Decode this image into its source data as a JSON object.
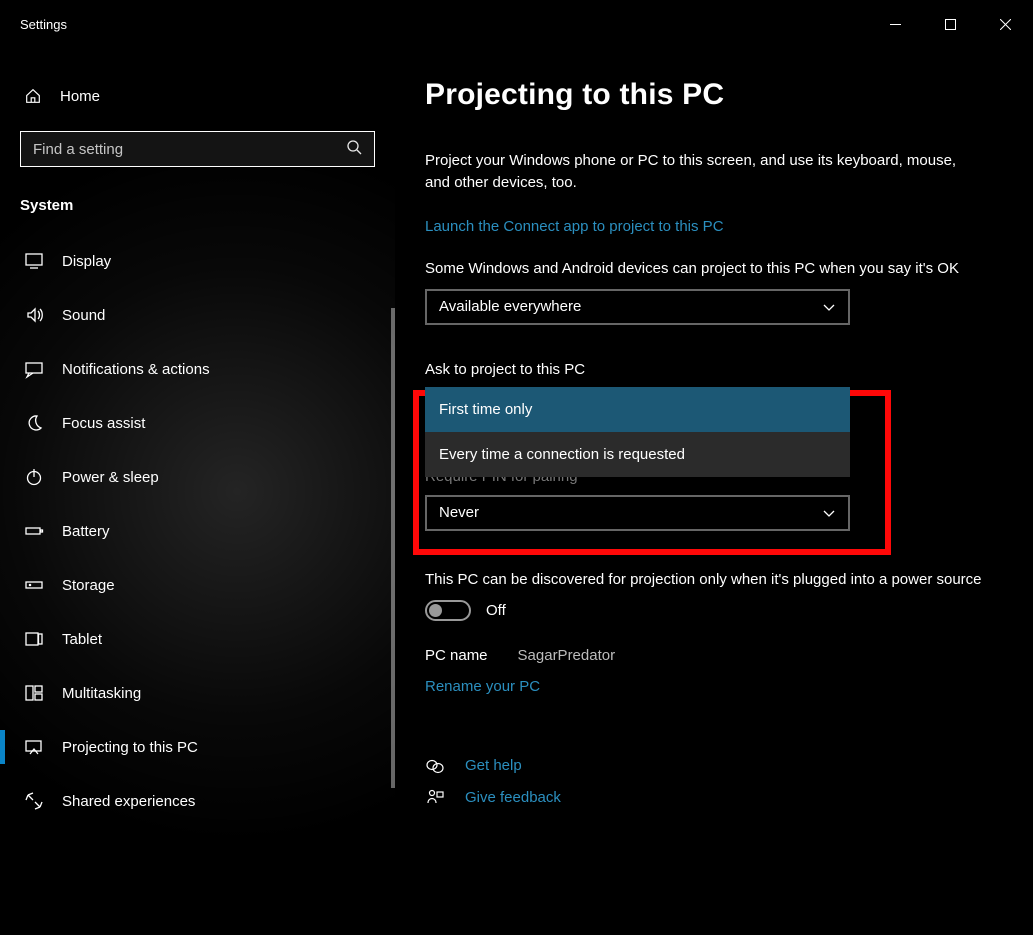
{
  "titlebar": {
    "title": "Settings"
  },
  "sidebar": {
    "home_label": "Home",
    "search_placeholder": "Find a setting",
    "section_label": "System",
    "items": [
      {
        "label": "Display",
        "icon": "monitor-icon",
        "active": false
      },
      {
        "label": "Sound",
        "icon": "speaker-icon",
        "active": false
      },
      {
        "label": "Notifications & actions",
        "icon": "message-icon",
        "active": false
      },
      {
        "label": "Focus assist",
        "icon": "moon-icon",
        "active": false
      },
      {
        "label": "Power & sleep",
        "icon": "power-icon",
        "active": false
      },
      {
        "label": "Battery",
        "icon": "battery-icon",
        "active": false
      },
      {
        "label": "Storage",
        "icon": "storage-icon",
        "active": false
      },
      {
        "label": "Tablet",
        "icon": "tablet-icon",
        "active": false
      },
      {
        "label": "Multitasking",
        "icon": "multitask-icon",
        "active": false
      },
      {
        "label": "Projecting to this PC",
        "icon": "project-icon",
        "active": true
      },
      {
        "label": "Shared experiences",
        "icon": "shared-icon",
        "active": false
      }
    ]
  },
  "main": {
    "title": "Projecting to this PC",
    "desc": "Project your Windows phone or PC to this screen, and use its keyboard, mouse, and other devices, too.",
    "launch_link": "Launch the Connect app to project to this PC",
    "availability_label": "Some Windows and Android devices can project to this PC when you say it's OK",
    "availability_value": "Available everywhere",
    "ask_label": "Ask to project to this PC",
    "ask_options": {
      "option1": "First time only",
      "option2": "Every time a connection is requested"
    },
    "pin_label": "Require PIN for pairing",
    "pin_value": "Never",
    "discover_note": "This PC can be discovered for projection only when it's plugged into a power source",
    "toggle_state": "Off",
    "pcname_key": "PC name",
    "pcname_val": "SagarPredator",
    "rename_link": "Rename your PC",
    "help_link": "Get help",
    "feedback_link": "Give feedback"
  }
}
